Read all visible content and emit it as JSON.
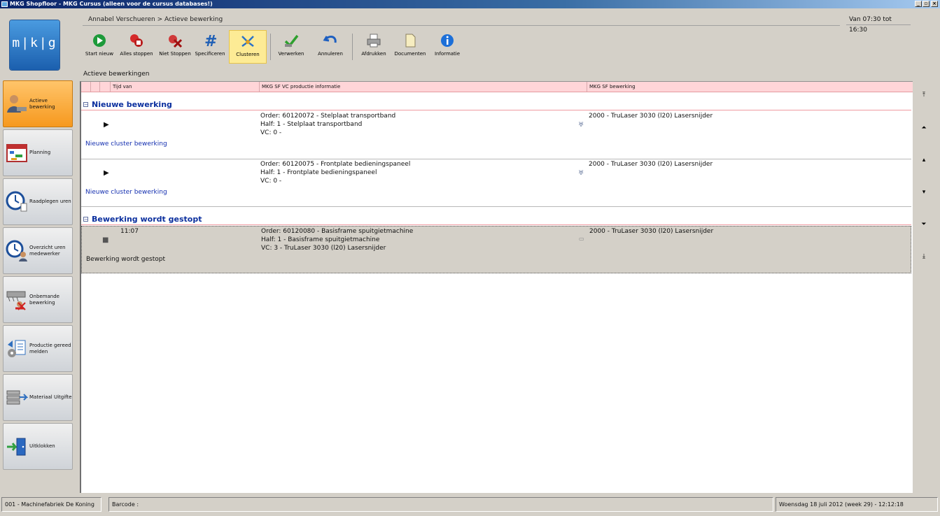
{
  "window": {
    "title": "MKG Shopfloor - MKG Cursus (alleen voor de cursus databases!)"
  },
  "logo_text": "m|k|g",
  "breadcrumb": "Annabel Verschueren > Actieve bewerking",
  "shift_time": "Van 07:30 tot 16:30",
  "toolbar": [
    {
      "label": "Start nieuw",
      "icon": "play-icon",
      "color": "#1d9a3a"
    },
    {
      "label": "Alles stoppen",
      "icon": "stop-all-icon",
      "color": "#d52a2a"
    },
    {
      "label": "Niet Stoppen",
      "icon": "not-stop-icon",
      "color": "#c02020"
    },
    {
      "label": "Specificeren",
      "icon": "hash-icon",
      "color": "#1f5fb5"
    },
    {
      "label": "Clusteren",
      "icon": "cluster-icon",
      "color": "#2a72c8"
    },
    {
      "label": "Verwerken",
      "icon": "checkmark-icon",
      "color": "#2ea02e"
    },
    {
      "label": "Annuleren",
      "icon": "undo-icon",
      "color": "#1e5fc0"
    },
    {
      "label": "Afdrukken",
      "icon": "printer-icon",
      "color": "#707070"
    },
    {
      "label": "Documenten",
      "icon": "document-icon",
      "color": "#e8d890"
    },
    {
      "label": "Informatie",
      "icon": "info-icon",
      "color": "#1c6fd8"
    }
  ],
  "section_caption": "Actieve bewerkingen",
  "nav": [
    {
      "label": "Actieve bewerking",
      "icon": "worker-icon",
      "active": true
    },
    {
      "label": "Planning",
      "icon": "calendar-icon",
      "active": false
    },
    {
      "label": "Raadplegen uren",
      "icon": "clock-icon",
      "active": false
    },
    {
      "label": "Overzicht uren medewerker",
      "icon": "clock-user-icon",
      "active": false
    },
    {
      "label": "Onbemande bewerking",
      "icon": "machine-icon",
      "active": false
    },
    {
      "label": "Productie gereed melden",
      "icon": "production-icon",
      "active": false
    },
    {
      "label": "Materiaal Uitgifte",
      "icon": "material-icon",
      "active": false
    },
    {
      "label": "Uitklokken",
      "icon": "clock-out-icon",
      "active": false
    }
  ],
  "columns": [
    "Tijd van",
    "MKG SF VC productie informatie",
    "MKG SF bewerking"
  ],
  "groups": [
    {
      "label": "Nieuwe bewerking",
      "rows": [
        {
          "time": "",
          "state": "play",
          "order": "Order: 60120072 - Stelplaat transportband",
          "half": "Half: 1 - Stelplaat transportband",
          "vc": "VC: 0 -",
          "operation": "2000 - TruLaser 3030 (l20) Lasersnijder",
          "link": "Nieuwe cluster bewerking"
        },
        {
          "time": "",
          "state": "play",
          "order": "Order: 60120075 - Frontplate bedieningspaneel",
          "half": "Half: 1 - Frontplate bedieningspaneel",
          "vc": "VC: 0 -",
          "operation": "2000 - TruLaser 3030 (l20) Lasersnijder",
          "link": "Nieuwe cluster bewerking"
        }
      ]
    },
    {
      "label": "Bewerking wordt gestopt",
      "rows": [
        {
          "time": "11:07",
          "state": "stop",
          "order": "Order: 60120080 - Basisframe spuitgietmachine",
          "half": "Half: 1 - Basisframe spuitgietmachine",
          "vc": "VC: 3 - TruLaser 3030 (l20) Lasersnijder",
          "operation": "2000 - TruLaser 3030 (l20) Lasersnijder",
          "link": "Bewerking wordt gestopt"
        }
      ]
    }
  ],
  "status": {
    "company": "001 - Machinefabriek De Koning",
    "barcode_label": "Barcode :",
    "datetime": "Woensdag 18 juli 2012 (week 29) - 12:12:18"
  }
}
